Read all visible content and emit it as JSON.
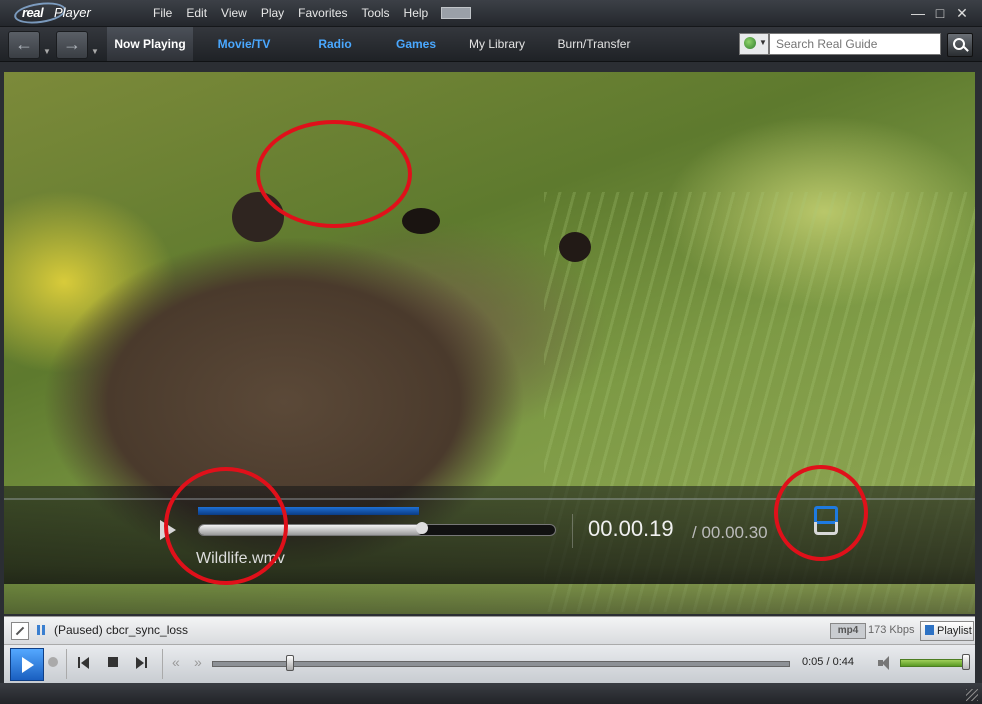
{
  "app": {
    "logo_real": "real",
    "logo_player": "Player"
  },
  "menu": [
    "File",
    "Edit",
    "View",
    "Play",
    "Favorites",
    "Tools",
    "Help"
  ],
  "tabs": {
    "now_playing": "Now Playing",
    "movie_tv": "Movie/TV",
    "radio": "Radio",
    "games": "Games",
    "my_library": "My Library",
    "burn_transfer": "Burn/Transfer"
  },
  "search": {
    "placeholder": "Search Real Guide"
  },
  "overlay": {
    "time_current": "00.00.19",
    "time_total": "/ 00.00.30",
    "filename": "Wildlife.wmv",
    "buffered": 0.62,
    "progress": 0.63
  },
  "status": {
    "message": "(Paused) cbcr_sync_loss",
    "format": "mp4",
    "bitrate": "173 Kbps",
    "playlist_label": "Playlist"
  },
  "transport": {
    "time": "0:05 / 0:44",
    "seek_progress": 0.13,
    "volume_level": 1.0
  },
  "colors": {
    "accent_blue": "#4aa8ff",
    "annotation_red": "#e0101a",
    "volume_green": "#7cbf3e"
  }
}
